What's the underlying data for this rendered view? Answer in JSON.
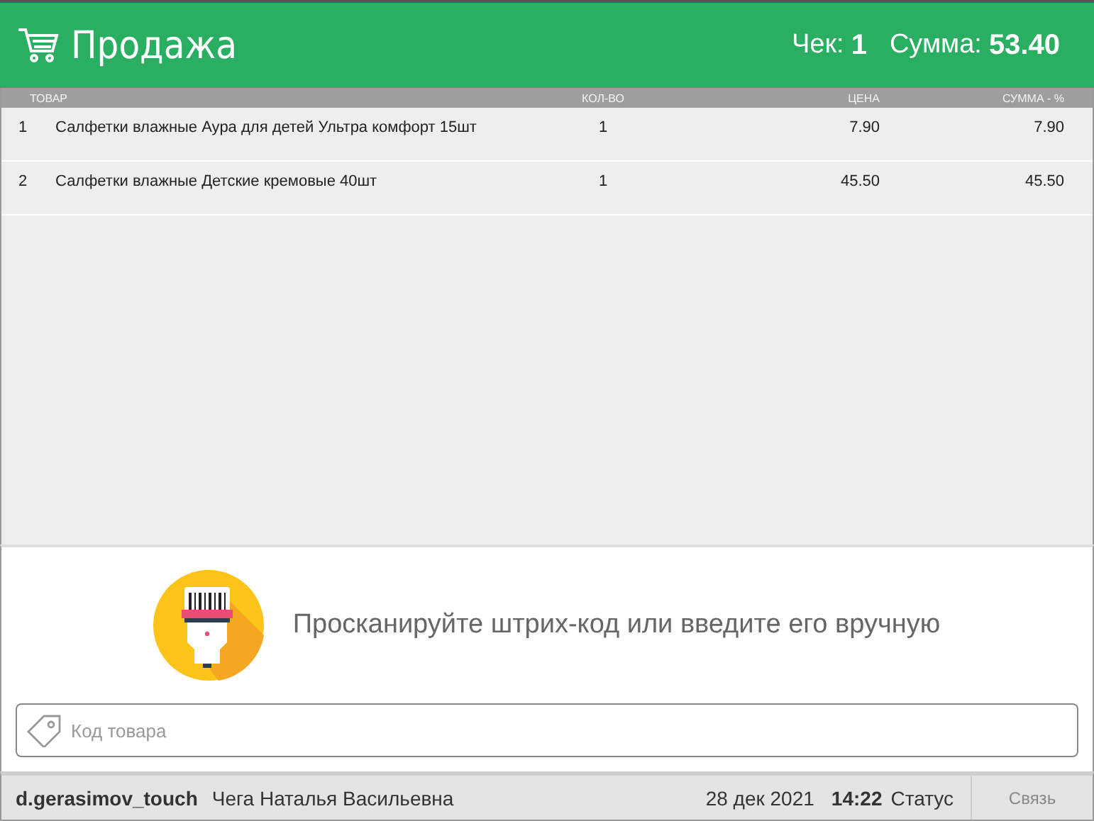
{
  "header": {
    "title": "Продажа",
    "check_label": "Чек:",
    "check_number": "1",
    "sum_label": "Сумма:",
    "sum_value": "53.40"
  },
  "table": {
    "columns": [
      "ТОВАР",
      "КОЛ-ВО",
      "ЦЕНА",
      "СУММА - %"
    ],
    "rows": [
      {
        "number": "1",
        "name": "Салфетки влажные Аура для детей Ультра комфорт 15шт",
        "qty": "1",
        "price": "7.90",
        "sum": "7.90"
      },
      {
        "number": "2",
        "name": "Салфетки влажные Детские кремовые 40шт",
        "qty": "1",
        "price": "45.50",
        "sum": "45.50"
      }
    ]
  },
  "scan_prompt": "Просканируйте штрих-код или введите его вручную",
  "code_field": {
    "placeholder": "Код товара"
  },
  "status_bar": {
    "user": "d.gerasimov_touch",
    "cashier": "Чега Наталья Васильевна",
    "date": "28 дек 2021",
    "time": "14:22",
    "status": "Статус",
    "connection": "Связь"
  }
}
